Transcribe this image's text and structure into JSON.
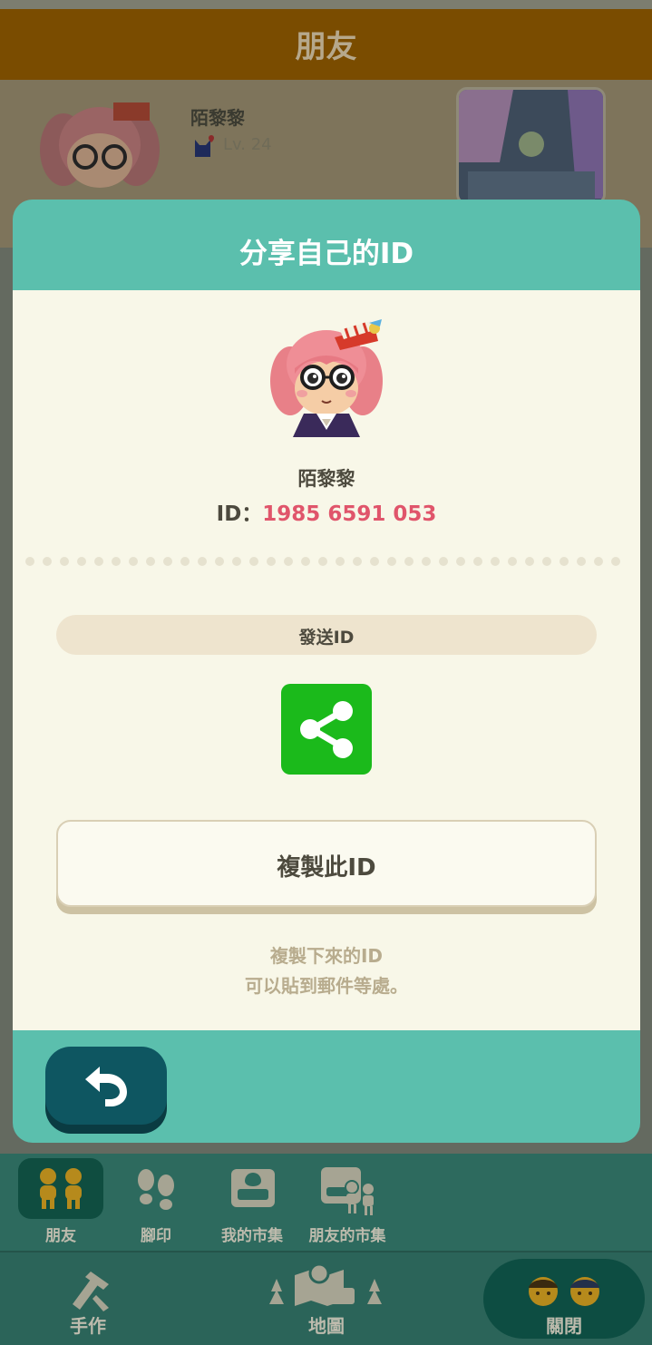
{
  "background": {
    "header_title": "朋友",
    "friend_name": "陌黎黎",
    "friend_level": "Lv. 24"
  },
  "modal": {
    "title": "分享自己的ID",
    "player_name": "陌黎黎",
    "id_label": "ID：",
    "id_value": "1985 6591 053",
    "send_label": "發送ID",
    "copy_button": "複製此ID",
    "hint_line1": "複製下來的ID",
    "hint_line2": "可以貼到郵件等處。",
    "share_icon": "share-icon",
    "back_icon": "undo-arrow-icon"
  },
  "nav": {
    "tabs": [
      {
        "label": "朋友",
        "icon": "friends-icon"
      },
      {
        "label": "腳印",
        "icon": "footprints-icon"
      },
      {
        "label": "我的市集",
        "icon": "my-market-icon"
      },
      {
        "label": "朋友的市集",
        "icon": "friends-market-icon"
      }
    ],
    "bottom": [
      {
        "label": "手作",
        "icon": "craft-icon"
      },
      {
        "label": "地圖",
        "icon": "map-icon"
      },
      {
        "label": "關閉",
        "icon": "close-faces-icon"
      }
    ]
  },
  "colors": {
    "teal": "#5bbfad",
    "cream": "#f8f7e8",
    "id_pink": "#e0556b",
    "share_green": "#1bba1b",
    "back_button": "#0e5661"
  }
}
